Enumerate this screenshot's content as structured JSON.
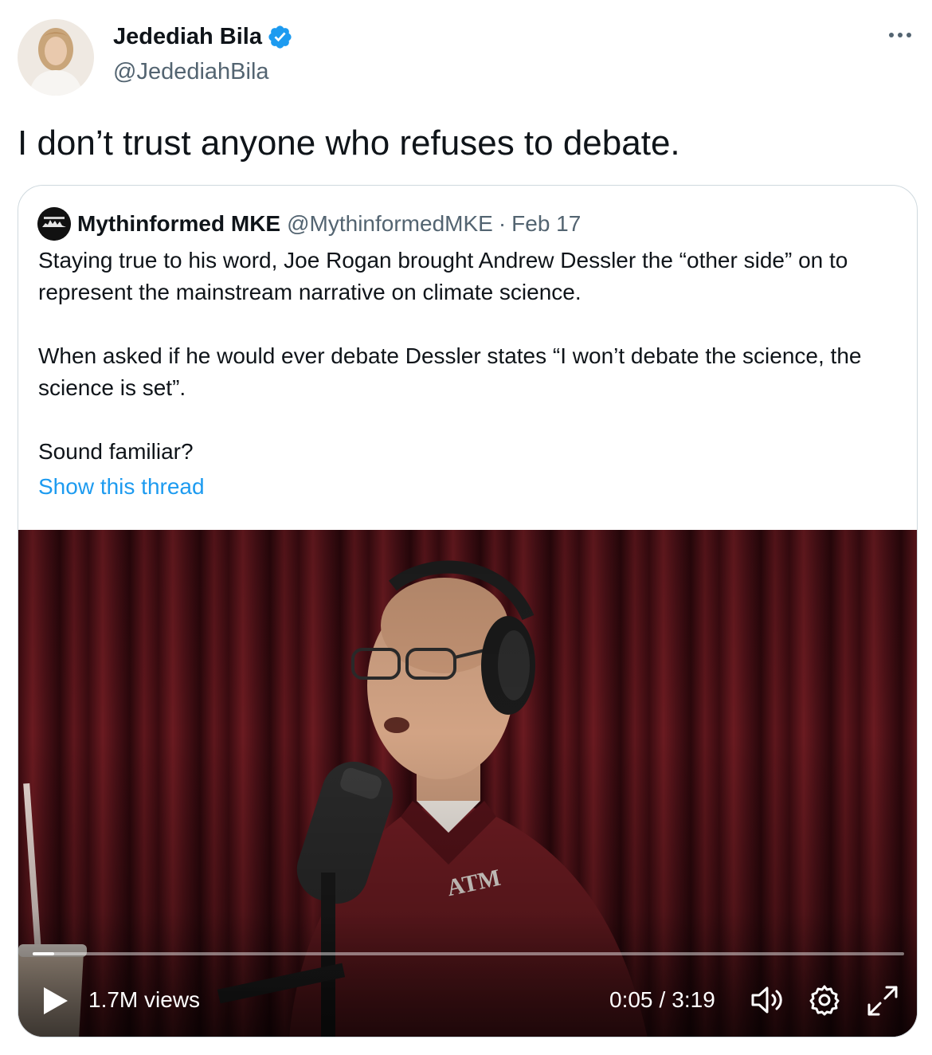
{
  "author": {
    "name": "Jedediah Bila",
    "handle": "@JedediahBila",
    "verified": true
  },
  "tweet": {
    "text": "I don’t trust anyone who refuses to debate."
  },
  "quoted": {
    "name": "Mythinformed MKE",
    "handle": "@MythinformedMKE",
    "separator": "·",
    "date": "Feb 17",
    "paragraphs": [
      "Staying true to his word, Joe Rogan brought Andrew Dessler the “other side” on to represent the mainstream narrative on climate science.",
      "When asked if he would ever debate Dessler states “I won’t debate the science, the science is set”.",
      "Sound familiar?"
    ],
    "show_thread": "Show this thread"
  },
  "video": {
    "views": "1.7M views",
    "current_time": "0:05",
    "time_separator": "/",
    "duration": "3:19",
    "progress_fraction": 0.025
  },
  "colors": {
    "accent": "#1d9bf0",
    "secondary_text": "#536471",
    "border": "#cfd9de"
  }
}
